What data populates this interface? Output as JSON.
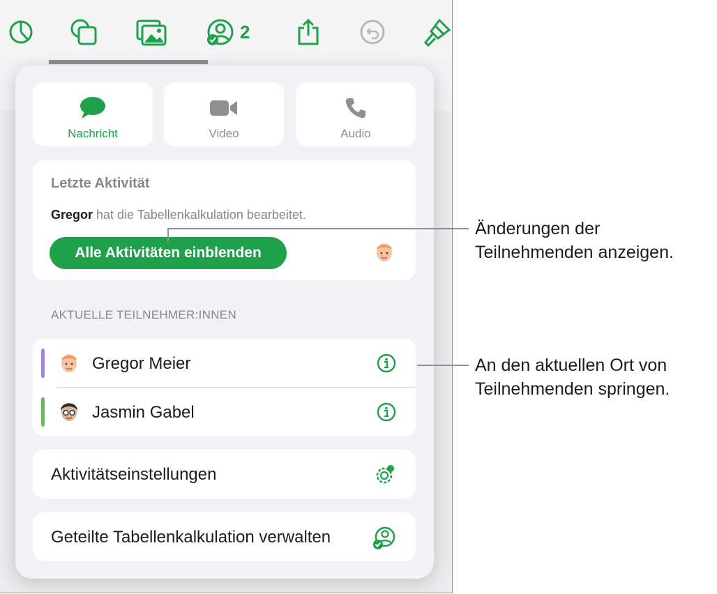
{
  "toolbar": {
    "collab_count": "2",
    "icons": [
      "chart-icon",
      "shapes-icon",
      "media-icon",
      "collaborate-icon",
      "share-icon",
      "undo-icon",
      "format-brush-icon"
    ]
  },
  "communication": {
    "message": {
      "label": "Nachricht",
      "icon": "message-bubble-icon"
    },
    "video": {
      "label": "Video",
      "icon": "video-camera-icon"
    },
    "audio": {
      "label": "Audio",
      "icon": "phone-icon"
    }
  },
  "recent_activity": {
    "title": "Letzte Aktivität",
    "user": "Gregor",
    "action": "hat die Tabellenkalkulation bearbeitet.",
    "button_label": "Alle Aktivitäten einblenden"
  },
  "participants": {
    "header": "AKTUELLE TEILNEHMER:INNEN",
    "items": [
      {
        "name": "Gregor Meier",
        "color": "#a97ff0"
      },
      {
        "name": "Jasmin Gabel",
        "color": "#5cc04a"
      }
    ]
  },
  "settings": {
    "activity_settings": "Aktivitätseinstellungen",
    "manage_shared": "Geteilte Tabellenkalkulation verwalten"
  },
  "callouts": {
    "show_changes": [
      "Änderungen der",
      "Teilnehmenden anzeigen."
    ],
    "jump_to": [
      "An den aktuellen Ort von",
      "Teilnehmenden springen."
    ]
  },
  "colors": {
    "accent": "#1fa04a",
    "muted": "#86868b",
    "background": "#f2f2f6"
  }
}
